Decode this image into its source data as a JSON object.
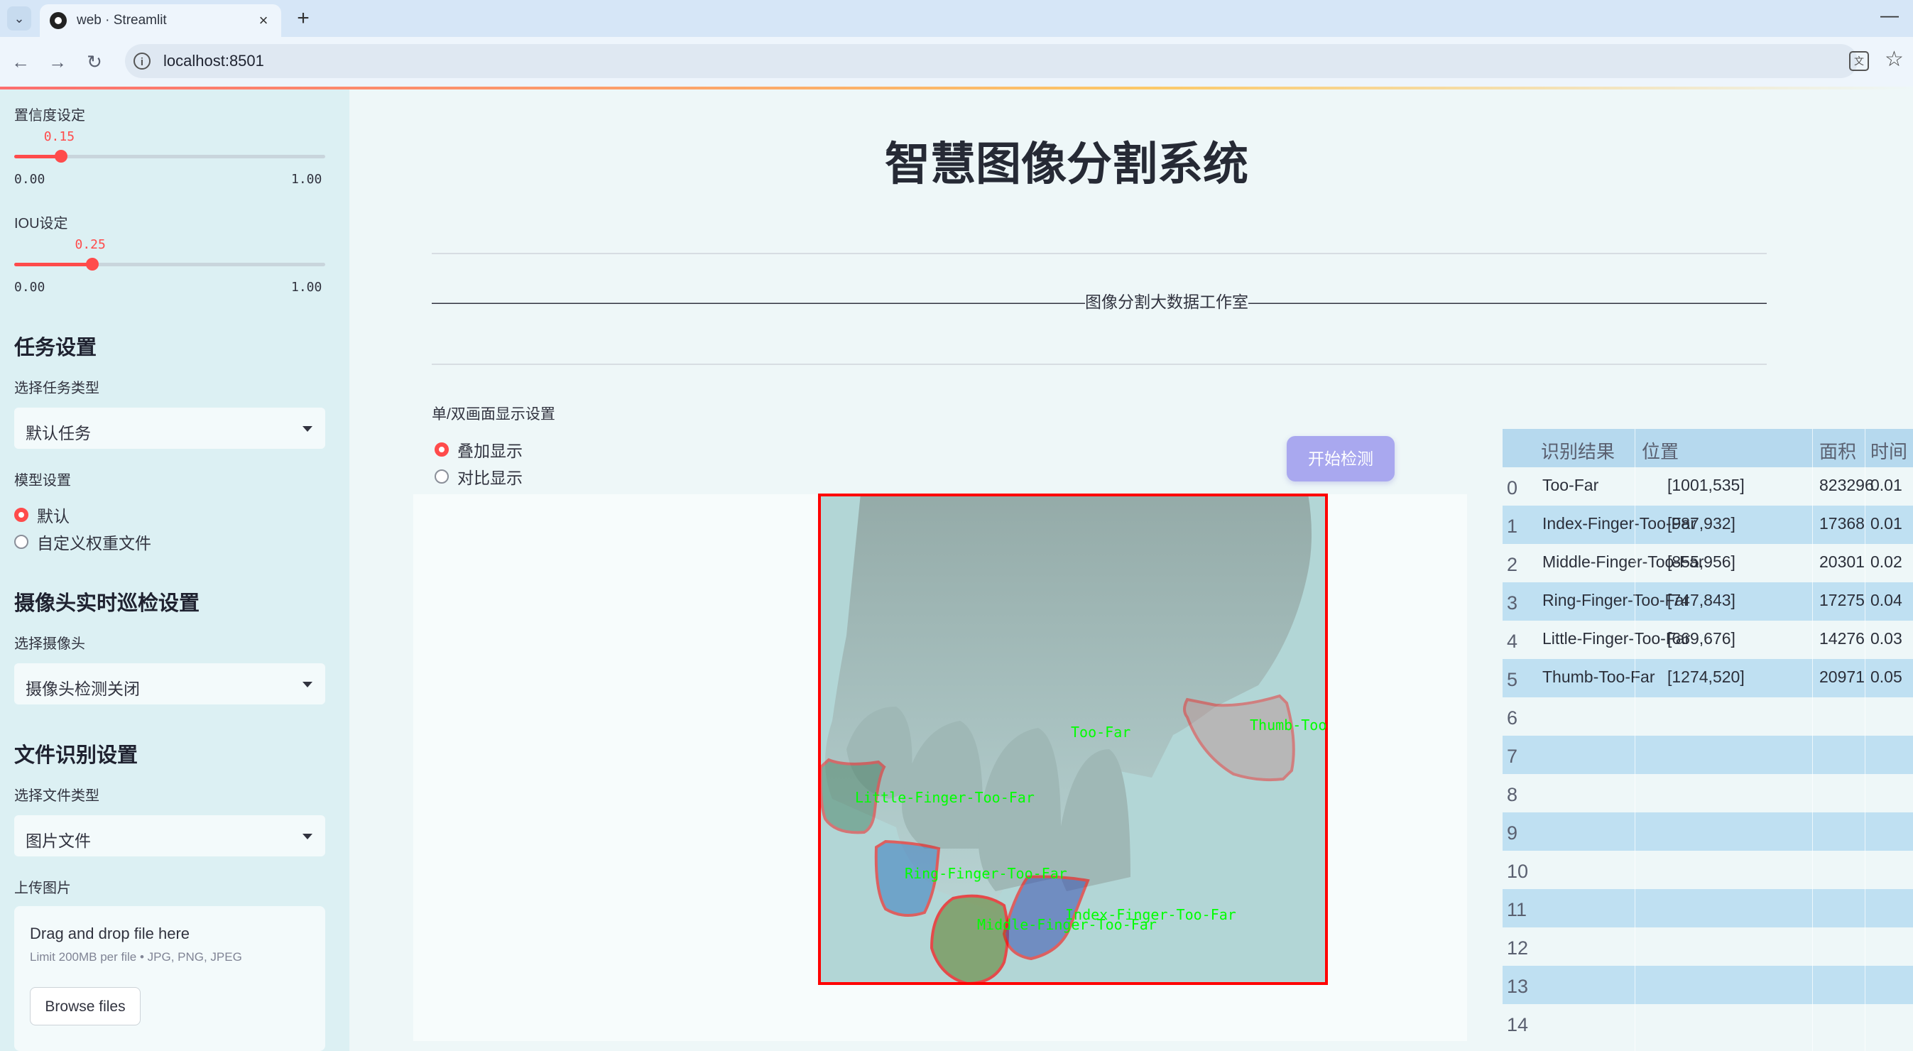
{
  "browser": {
    "tab_title": "web · Streamlit",
    "tab_close": "×",
    "new_tab": "+",
    "url": "localhost:8501",
    "minimize": "—"
  },
  "sidebar": {
    "confidence": {
      "label": "置信度设定",
      "value": "0.15",
      "fraction": 0.15,
      "min": "0.00",
      "max": "1.00"
    },
    "iou": {
      "label": "IOU设定",
      "value": "0.25",
      "fraction": 0.25,
      "min": "0.00",
      "max": "1.00"
    },
    "task_heading": "任务设置",
    "task_type_label": "选择任务类型",
    "task_type_value": "默认任务",
    "model_label": "模型设置",
    "model_options": [
      "默认",
      "自定义权重文件"
    ],
    "model_selected": 0,
    "camera_heading": "摄像头实时巡检设置",
    "camera_label": "选择摄像头",
    "camera_value": "摄像头检测关闭",
    "file_heading": "文件识别设置",
    "file_type_label": "选择文件类型",
    "file_type_value": "图片文件",
    "upload_label": "上传图片",
    "upload_title": "Drag and drop file here",
    "upload_limit": "Limit 200MB per file • JPG, PNG, JPEG",
    "browse_label": "Browse files"
  },
  "main": {
    "title": "智慧图像分割系统",
    "banner": "————————————————————————————————————————图像分割大数据工作室————————————————————————————————————————",
    "display_label": "单/双画面显示设置",
    "display_options": [
      "叠加显示",
      "对比显示"
    ],
    "display_selected": 0,
    "start_button": "开始检测",
    "detections": [
      {
        "label": "Too-Far"
      },
      {
        "label": "Thumb-Too-Far"
      },
      {
        "label": "Little-Finger-Too-Far"
      },
      {
        "label": "Ring-Finger-Too-Far"
      },
      {
        "label": "Index-Finger-Too-Far"
      },
      {
        "label": "Middle-Finger-Too-Far"
      }
    ]
  },
  "table": {
    "columns": [
      "识别结果",
      "位置",
      "面积",
      "时间"
    ],
    "rows": [
      {
        "index": "0",
        "result": "Too-Far",
        "position": "[1001,535]",
        "area": "823296",
        "time": "0.01"
      },
      {
        "index": "1",
        "result": "Index-Finger-Too-Far",
        "position": "[987,932]",
        "area": "17368",
        "time": "0.01"
      },
      {
        "index": "2",
        "result": "Middle-Finger-Too-Far",
        "position": "[855,956]",
        "area": "20301",
        "time": "0.02"
      },
      {
        "index": "3",
        "result": "Ring-Finger-Too-Far",
        "position": "[747,843]",
        "area": "17275",
        "time": "0.04"
      },
      {
        "index": "4",
        "result": "Little-Finger-Too-Far",
        "position": "[669,676]",
        "area": "14276",
        "time": "0.03"
      },
      {
        "index": "5",
        "result": "Thumb-Too-Far",
        "position": "[1274,520]",
        "area": "20971",
        "time": "0.05"
      },
      {
        "index": "6"
      },
      {
        "index": "7"
      },
      {
        "index": "8"
      },
      {
        "index": "9"
      },
      {
        "index": "10"
      },
      {
        "index": "11"
      },
      {
        "index": "12"
      },
      {
        "index": "13"
      },
      {
        "index": "14"
      }
    ]
  },
  "colors": {
    "accent": "#ff4b4b",
    "button": "#a9a8ef",
    "table_alt": "#bfe0f2",
    "mask_outline": "#ff0000",
    "mask_label": "#00ff00"
  }
}
